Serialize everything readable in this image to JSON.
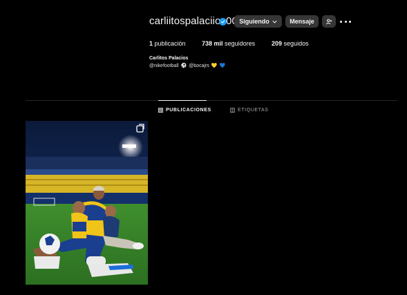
{
  "profile": {
    "username": "carliitospalaciios00",
    "follow_button": "Siguiendo",
    "message_button": "Mensaje",
    "stats": {
      "posts_count": "1",
      "posts_label": "publicación",
      "followers_count": "738 mil",
      "followers_label": "seguidores",
      "following_count": "209",
      "following_label": "seguidos"
    },
    "full_name": "Carlitos Palacios",
    "bio_mention_1": "@nikefootball",
    "bio_mention_2": "@bocajrs",
    "bio_emojis": [
      "⚽",
      "💛",
      "💙"
    ]
  },
  "tabs": [
    {
      "label": "PUBLICACIONES",
      "active": true
    },
    {
      "label": "ETIQUETAS",
      "active": false
    }
  ],
  "colors": {
    "background": "#000000",
    "button": "#363636",
    "verified": "#1d9bf0",
    "divider": "#262626"
  }
}
